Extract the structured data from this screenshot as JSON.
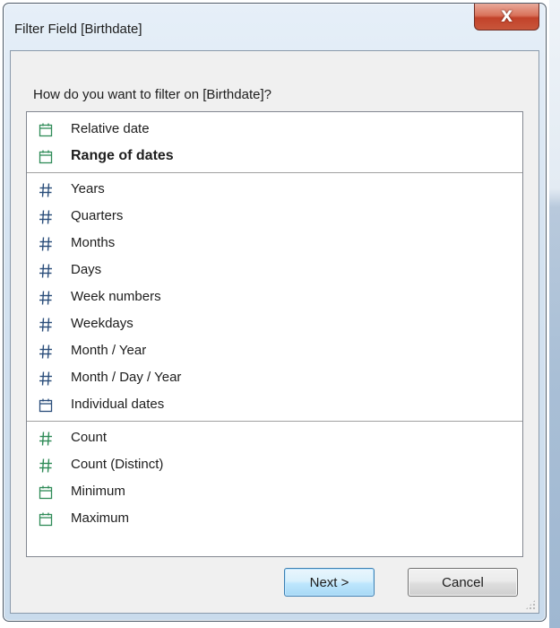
{
  "window": {
    "title": "Filter Field [Birthdate]",
    "close_glyph": "X"
  },
  "prompt": "How do you want to filter on [Birthdate]?",
  "groups": [
    {
      "items": [
        {
          "label": "Relative date",
          "icon": "calendar-icon",
          "icon_color": "#2e8b57",
          "bold": false
        },
        {
          "label": "Range of dates",
          "icon": "calendar-icon",
          "icon_color": "#2e8b57",
          "bold": true
        }
      ]
    },
    {
      "items": [
        {
          "label": "Years",
          "icon": "hash-icon",
          "icon_color": "#2a4d7a",
          "bold": false
        },
        {
          "label": "Quarters",
          "icon": "hash-icon",
          "icon_color": "#2a4d7a",
          "bold": false
        },
        {
          "label": "Months",
          "icon": "hash-icon",
          "icon_color": "#2a4d7a",
          "bold": false
        },
        {
          "label": "Days",
          "icon": "hash-icon",
          "icon_color": "#2a4d7a",
          "bold": false
        },
        {
          "label": "Week numbers",
          "icon": "hash-icon",
          "icon_color": "#2a4d7a",
          "bold": false
        },
        {
          "label": "Weekdays",
          "icon": "hash-icon",
          "icon_color": "#2a4d7a",
          "bold": false
        },
        {
          "label": "Month / Year",
          "icon": "hash-icon",
          "icon_color": "#2a4d7a",
          "bold": false
        },
        {
          "label": "Month / Day / Year",
          "icon": "hash-icon",
          "icon_color": "#2a4d7a",
          "bold": false
        },
        {
          "label": "Individual dates",
          "icon": "calendar-icon",
          "icon_color": "#2a4d7a",
          "bold": false
        }
      ]
    },
    {
      "items": [
        {
          "label": "Count",
          "icon": "hash-icon",
          "icon_color": "#2e8b57",
          "bold": false
        },
        {
          "label": "Count (Distinct)",
          "icon": "hash-icon",
          "icon_color": "#2e8b57",
          "bold": false
        },
        {
          "label": "Minimum",
          "icon": "calendar-icon",
          "icon_color": "#2e8b57",
          "bold": false
        },
        {
          "label": "Maximum",
          "icon": "calendar-icon",
          "icon_color": "#2e8b57",
          "bold": false
        }
      ]
    }
  ],
  "buttons": {
    "next": "Next >",
    "cancel": "Cancel"
  }
}
